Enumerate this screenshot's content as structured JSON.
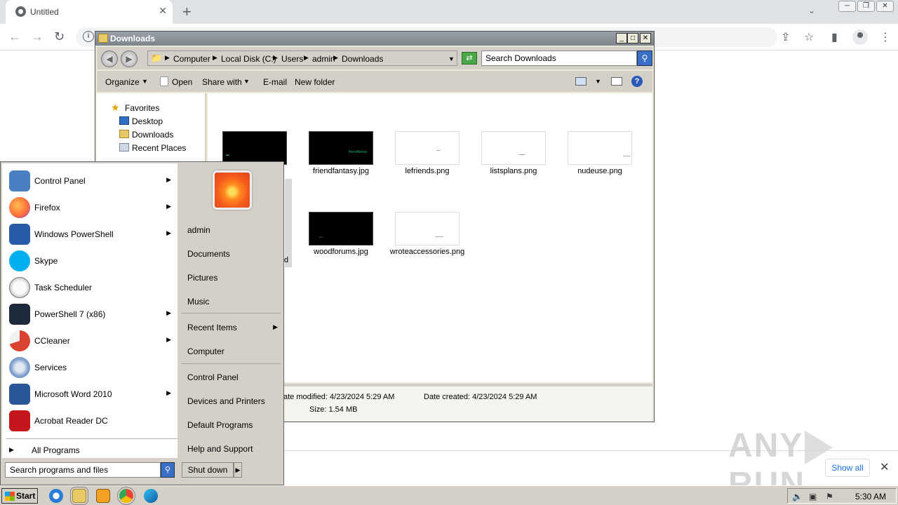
{
  "browser": {
    "tab_title": "Untitled",
    "tab_close": "✕",
    "new_tab": "+",
    "show_all": "Show all",
    "download_close": "✕"
  },
  "watermark": {
    "left": "ANY",
    "right": "RUN"
  },
  "explorer": {
    "title": "Downloads",
    "breadcrumb": [
      "Computer",
      "Local Disk (C:)",
      "Users",
      "admin",
      "Downloads"
    ],
    "search_placeholder": "Search Downloads",
    "toolbar": {
      "organize": "Organize",
      "open": "Open",
      "share_with": "Share with",
      "email": "E-mail",
      "new_folder": "New folder"
    },
    "nav": {
      "favorites": "Favorites",
      "desktop": "Desktop",
      "downloads": "Downloads",
      "recent_places": "Recent Places"
    },
    "files": [
      {
        "name": "friendfantasy.jpg",
        "thumb": "dark",
        "mark": "friendfantas"
      },
      {
        "name": "lefriends.png",
        "thumb": "light"
      },
      {
        "name": "listsplans.png",
        "thumb": "light"
      },
      {
        "name": "nudeuse.png",
        "thumb": "light"
      },
      {
        "name": "woodforums.jpg",
        "thumb": "dark"
      },
      {
        "name": "wroteaccessories.png",
        "thumb": "light"
      }
    ],
    "partial_label": "d",
    "details": {
      "date_modified": "ate modified:  4/23/2024 5:29 AM",
      "date_created": "Date created:  4/23/2024 5:29 AM",
      "size": "Size:  1.54 MB"
    }
  },
  "start_menu": {
    "programs": [
      {
        "label": "Control Panel",
        "has_sub": true,
        "color": "#4a7fc1"
      },
      {
        "label": "Firefox",
        "has_sub": true,
        "color": "#ff7139"
      },
      {
        "label": "Windows PowerShell",
        "has_sub": true,
        "color": "#2a5ba8"
      },
      {
        "label": "Skype",
        "has_sub": false,
        "color": "#00aff0"
      },
      {
        "label": "Task Scheduler",
        "has_sub": false,
        "color": "#c8c8c8"
      },
      {
        "label": "PowerShell 7 (x86)",
        "has_sub": true,
        "color": "#1d2a3b"
      },
      {
        "label": "CCleaner",
        "has_sub": true,
        "color": "#d9432f"
      },
      {
        "label": "Services",
        "has_sub": false,
        "color": "#7a9cc9"
      },
      {
        "label": "Microsoft Word 2010",
        "has_sub": true,
        "color": "#2b579a"
      },
      {
        "label": "Acrobat Reader DC",
        "has_sub": false,
        "color": "#c4161c"
      }
    ],
    "all_programs": "All Programs",
    "search_placeholder": "Search programs and files",
    "right_links": {
      "user": "admin",
      "documents": "Documents",
      "pictures": "Pictures",
      "music": "Music",
      "recent_items": "Recent Items",
      "computer": "Computer",
      "control_panel": "Control Panel",
      "devices_printers": "Devices and Printers",
      "default_programs": "Default Programs",
      "help_support": "Help and Support"
    },
    "shutdown": "Shut down"
  },
  "taskbar": {
    "start": "Start",
    "clock": "5:30 AM"
  }
}
